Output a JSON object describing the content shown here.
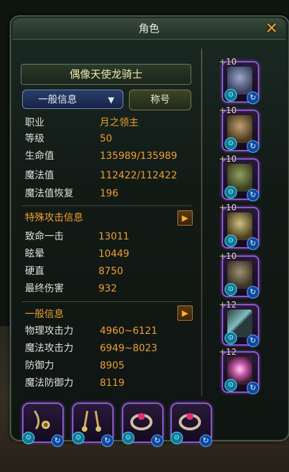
{
  "window": {
    "title": "角色"
  },
  "character": {
    "name": "偶像天使龙骑士"
  },
  "tabs": {
    "dropdown_label": "一般信息",
    "title_button": "称号"
  },
  "stats": [
    {
      "label": "职业",
      "value": "月之领主"
    },
    {
      "label": "等级",
      "value": "50"
    },
    {
      "label": "生命值",
      "value": "135989/135989"
    },
    {
      "label": "魔法值",
      "value": "112422/112422"
    },
    {
      "label": "魔法值恢复",
      "value": "196"
    }
  ],
  "special_attack": {
    "heading": "特殊攻击信息",
    "rows": [
      {
        "label": "致命一击",
        "value": "13011"
      },
      {
        "label": "眩晕",
        "value": "10449"
      },
      {
        "label": "硬直",
        "value": "8750"
      },
      {
        "label": "最终伤害",
        "value": "932"
      }
    ]
  },
  "general_info": {
    "heading": "一般信息",
    "rows": [
      {
        "label": "物理攻击力",
        "value": "4960~6121"
      },
      {
        "label": "魔法攻击力",
        "value": "6949~8023"
      },
      {
        "label": "防御力",
        "value": "8905"
      },
      {
        "label": "魔法防御力",
        "value": "8119"
      }
    ]
  },
  "equipment_right": [
    {
      "plus": "+10",
      "icon": "helmet-icon",
      "color": "#6a7aa0"
    },
    {
      "plus": "+10",
      "icon": "armor-icon",
      "color": "#8a7050"
    },
    {
      "plus": "+10",
      "icon": "gauntlet-icon",
      "color": "#607040"
    },
    {
      "plus": "+10",
      "icon": "leggings-icon",
      "color": "#a09060"
    },
    {
      "plus": "+10",
      "icon": "boots-icon",
      "color": "#706858"
    },
    {
      "plus": "+12",
      "icon": "spear-icon",
      "color": "#70a0a0"
    },
    {
      "plus": "+12",
      "icon": "orb-icon",
      "color": "#c060a0"
    }
  ],
  "equipment_bottom": [
    {
      "icon": "earring-icon"
    },
    {
      "icon": "earring-icon"
    },
    {
      "icon": "ring-icon"
    },
    {
      "icon": "ring-icon"
    }
  ],
  "colors": {
    "accent": "#f0a030",
    "frame": "#8a5ac8"
  }
}
